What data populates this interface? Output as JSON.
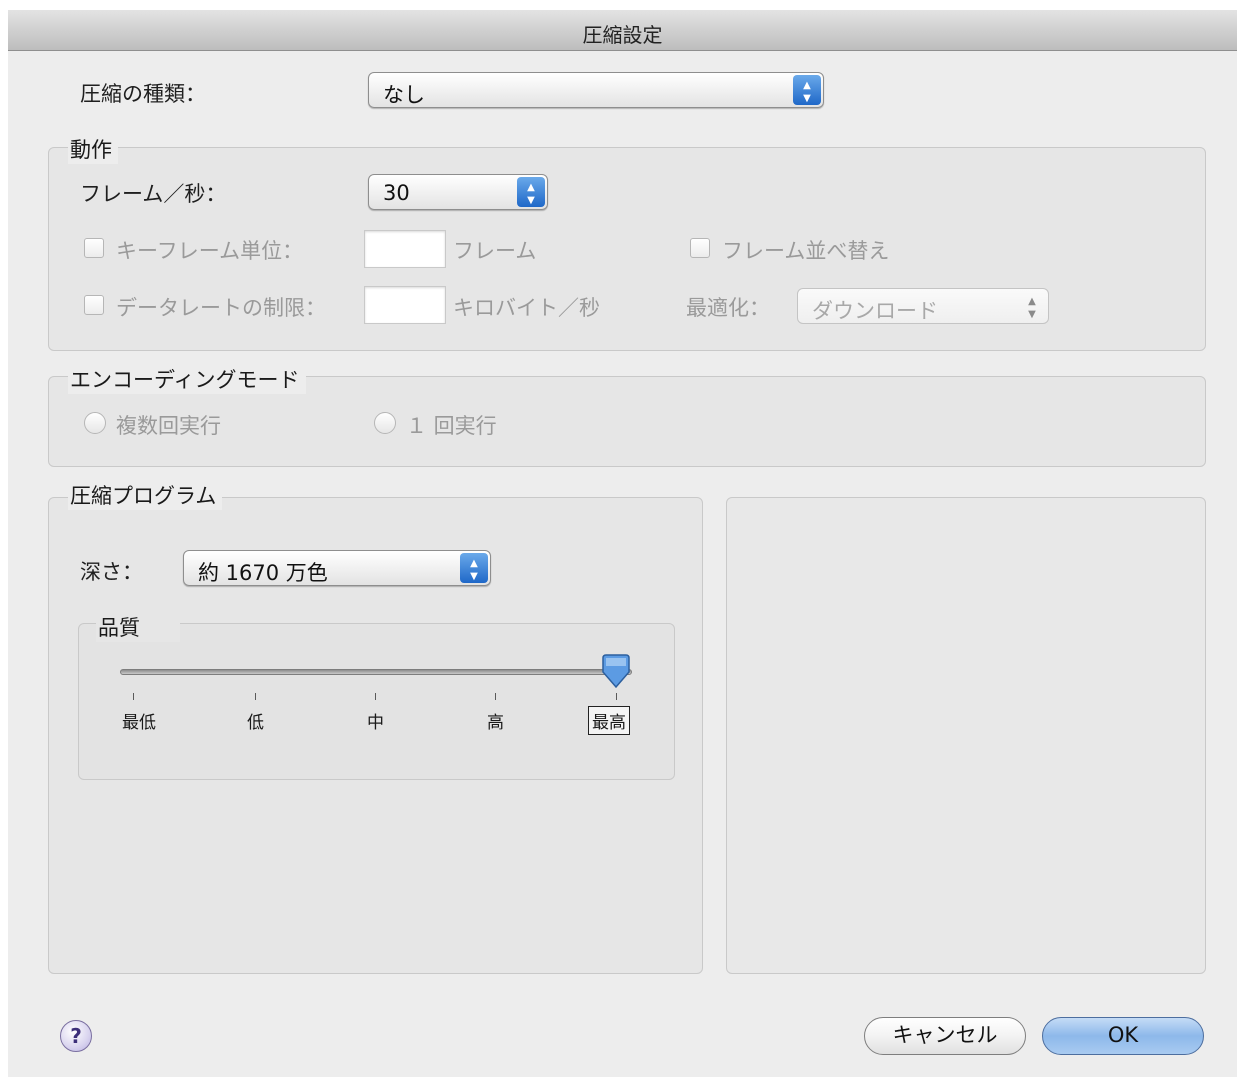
{
  "window": {
    "title": "圧縮設定"
  },
  "compression_type": {
    "label": "圧縮の種類：",
    "value": "なし"
  },
  "motion": {
    "title": "動作",
    "fps_label": "フレーム／秒：",
    "fps_value": "30",
    "keyframe_label": "キーフレーム単位：",
    "keyframe_value": "",
    "keyframe_unit": "フレーム",
    "reorder_label": "フレーム並べ替え",
    "datarate_label": "データレートの制限：",
    "datarate_value": "",
    "datarate_unit": "キロバイト／秒",
    "optimize_label": "最適化：",
    "optimize_value": "ダウンロード"
  },
  "encoding": {
    "title": "エンコーディングモード",
    "multi_pass": "複数回実行",
    "single_pass": "１ 回実行"
  },
  "compressor": {
    "title": "圧縮プログラム",
    "depth_label": "深さ：",
    "depth_value": "約 1670 万色",
    "quality": {
      "title": "品質",
      "levels": [
        "最低",
        "低",
        "中",
        "高",
        "最高"
      ],
      "selected": "最高"
    }
  },
  "buttons": {
    "help": "?",
    "cancel": "キャンセル",
    "ok": "OK"
  },
  "colors": {
    "accent_blue": "#2f78d6",
    "ok_blue": "#9cc3ee"
  }
}
